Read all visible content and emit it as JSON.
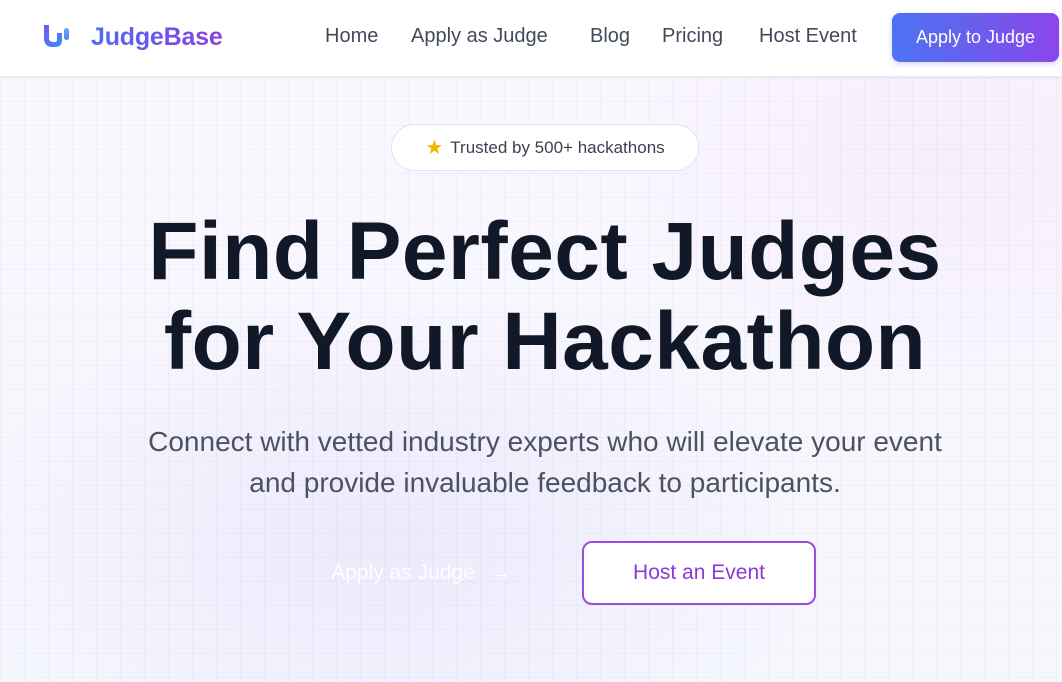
{
  "brand": {
    "name": "JudgeBase",
    "accent_start": "#4f6df5",
    "accent_end": "#8b3fe0"
  },
  "nav": {
    "items": [
      {
        "label": "Home"
      },
      {
        "label": "Apply as Judge"
      },
      {
        "label": "Blog"
      },
      {
        "label": "Pricing"
      },
      {
        "label": "Host Event"
      }
    ],
    "cta_label": "Apply to Judge"
  },
  "hero": {
    "badge": {
      "icon": "star-icon",
      "text": "Trusted by 500+ hackathons"
    },
    "headline": {
      "line1": "Find Perfect Judges",
      "line2": "for Your Hackathon"
    },
    "subtitle": {
      "line1": "Connect with vetted industry experts who will elevate your event",
      "line2": "and provide invaluable feedback to participants."
    },
    "primary_button": {
      "label": "Apply as Judge",
      "icon": "arrow-right-icon"
    },
    "secondary_button": {
      "label": "Host an Event",
      "color": "#8a3ad8"
    }
  }
}
